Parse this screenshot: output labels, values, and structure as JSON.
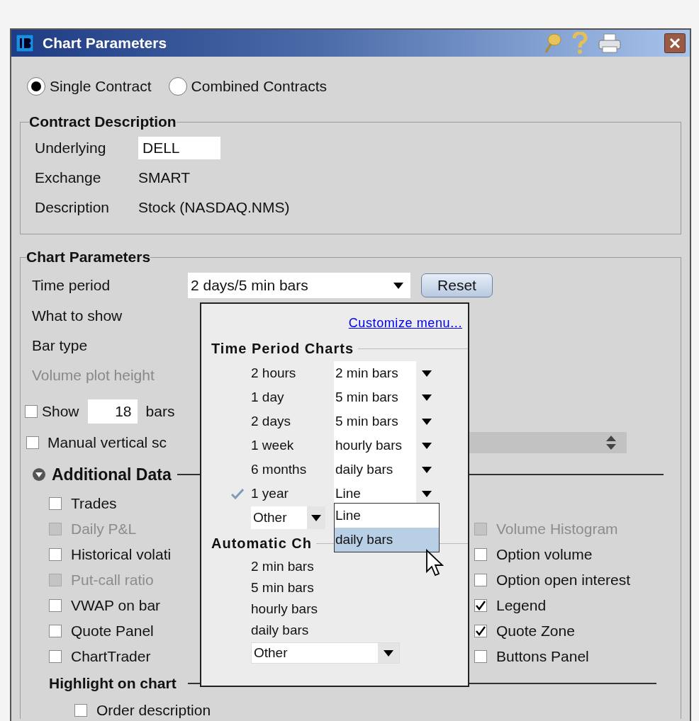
{
  "window": {
    "title": "Chart Parameters"
  },
  "contract_type": [
    {
      "label": "Single Contract",
      "selected": true
    },
    {
      "label": "Combined Contracts",
      "selected": false
    }
  ],
  "contract_description": {
    "title": "Contract Description",
    "fields": [
      {
        "label": "Underlying",
        "value": "DELL",
        "kind": "input"
      },
      {
        "label": "Exchange",
        "value": "SMART",
        "kind": "text"
      },
      {
        "label": "Description",
        "value": "Stock (NASDAQ.NMS)",
        "kind": "text"
      }
    ]
  },
  "chart_parameters": {
    "title": "Chart Parameters",
    "time_period": {
      "label": "Time period",
      "value": "2 days/5 min bars"
    },
    "reset": "Reset",
    "rows": [
      {
        "label": "What to show",
        "disabled": false
      },
      {
        "label": "Bar type",
        "disabled": false
      },
      {
        "label": "Volume plot height",
        "disabled": true
      }
    ],
    "show": {
      "checked": false,
      "label": "Show",
      "value": "18",
      "suffix": "bars"
    },
    "manual_scale": {
      "checked": false,
      "label": "Manual vertical sc"
    }
  },
  "additional_data": {
    "title": "Additional Data",
    "expanded": true,
    "left": [
      {
        "label": "Trades",
        "checked": false,
        "disabled": false
      },
      {
        "label": "Daily P&L",
        "checked": false,
        "disabled": true
      },
      {
        "label": "Historical volati",
        "checked": false,
        "disabled": false
      },
      {
        "label": "Put-call ratio",
        "checked": false,
        "disabled": true
      },
      {
        "label": "VWAP on bar",
        "checked": false,
        "disabled": false
      },
      {
        "label": "Quote Panel",
        "checked": false,
        "disabled": false
      },
      {
        "label": "ChartTrader",
        "checked": false,
        "disabled": false
      }
    ],
    "right": [
      {
        "label": "Volume Histogram",
        "checked": false,
        "disabled": true
      },
      {
        "label": "Option volume",
        "checked": false,
        "disabled": false
      },
      {
        "label": "Option open interest",
        "checked": false,
        "disabled": false
      },
      {
        "label": "Legend",
        "checked": true,
        "disabled": false
      },
      {
        "label": "Quote Zone",
        "checked": true,
        "disabled": false
      },
      {
        "label": "Buttons Panel",
        "checked": false,
        "disabled": false
      }
    ]
  },
  "highlight": {
    "title": "Highlight on chart",
    "items": [
      {
        "label": "Order description",
        "checked": false
      }
    ]
  },
  "time_period_menu": {
    "link": "Customize menu...",
    "title": "Time Period Charts",
    "periods": [
      {
        "period": "2 hours",
        "bars": "2 min bars",
        "checked": false
      },
      {
        "period": "1 day",
        "bars": "5 min bars",
        "checked": false
      },
      {
        "period": "2 days",
        "bars": "5 min bars",
        "checked": false
      },
      {
        "period": "1 week",
        "bars": "hourly bars",
        "checked": false
      },
      {
        "period": "6 months",
        "bars": "daily bars",
        "checked": false
      },
      {
        "period": "1 year",
        "bars": "Line",
        "checked": true
      }
    ],
    "other": "Other",
    "options": [
      {
        "label": "Line",
        "selected": false
      },
      {
        "label": "daily bars",
        "selected": true
      }
    ],
    "automatic_title": "Automatic Ch",
    "automatic": [
      "2 min bars",
      "5 min bars",
      "hourly bars",
      "daily bars"
    ],
    "automatic_other": "Other"
  }
}
